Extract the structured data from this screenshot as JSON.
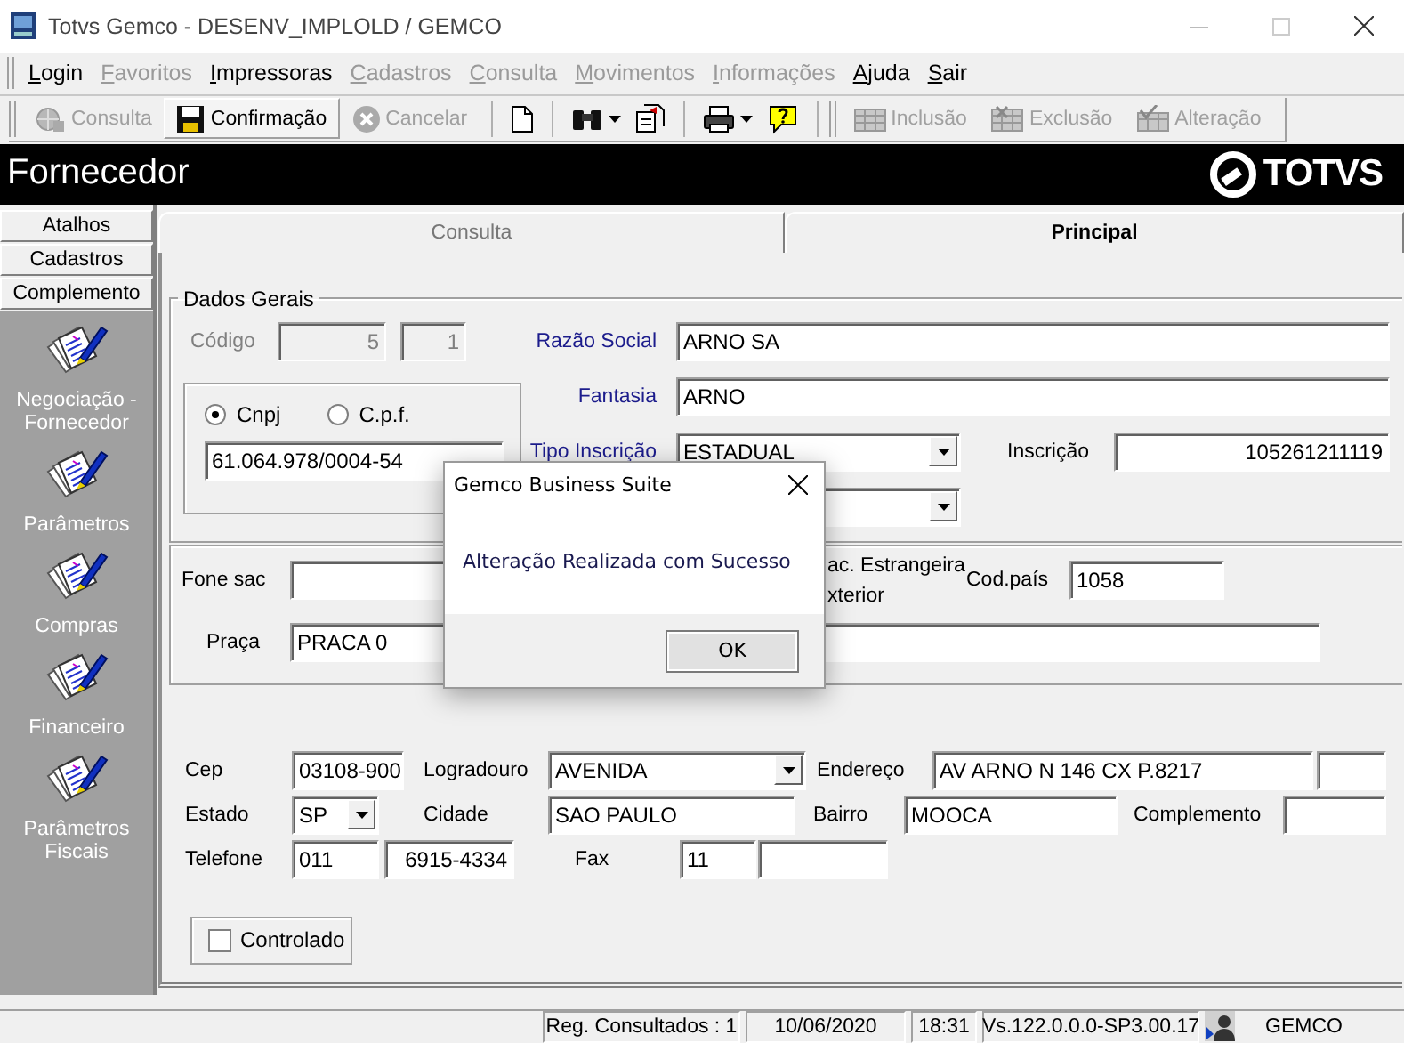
{
  "window": {
    "title": "Totvs Gemco - DESENV_IMPLOLD / GEMCO"
  },
  "menu": [
    {
      "label": "Login",
      "disabled": false
    },
    {
      "label": "Favoritos",
      "disabled": true
    },
    {
      "label": "Impressoras",
      "disabled": false
    },
    {
      "label": "Cadastros",
      "disabled": true
    },
    {
      "label": "Consulta",
      "disabled": true
    },
    {
      "label": "Movimentos",
      "disabled": true
    },
    {
      "label": "Informações",
      "disabled": true
    },
    {
      "label": "Ajuda",
      "disabled": false
    },
    {
      "label": "Sair",
      "disabled": false
    }
  ],
  "toolbar": {
    "left_buttons": [
      {
        "label": "Consulta",
        "disabled": true
      },
      {
        "label": "Confirmação",
        "disabled": false
      },
      {
        "label": "Cancelar",
        "disabled": true
      }
    ],
    "right_buttons": [
      {
        "label": "Inclusão",
        "disabled": true
      },
      {
        "label": "Exclusão",
        "disabled": true
      },
      {
        "label": "Alteração",
        "disabled": true
      }
    ]
  },
  "header": {
    "title": "Fornecedor",
    "logo": "TOTVS"
  },
  "sidebar": {
    "sections": [
      {
        "label": "Atalhos"
      },
      {
        "label": "Cadastros"
      },
      {
        "label": "Complemento"
      }
    ],
    "items": [
      {
        "label": "Negociação - Fornecedor"
      },
      {
        "label": "Parâmetros"
      },
      {
        "label": "Compras"
      },
      {
        "label": "Financeiro"
      },
      {
        "label": "Parâmetros Fiscais"
      }
    ]
  },
  "tabs": [
    {
      "label": "Consulta",
      "selected": false
    },
    {
      "label": "Principal",
      "selected": true
    }
  ],
  "form": {
    "dados_gerais": {
      "legend": "Dados Gerais",
      "codigo": {
        "label": "Código",
        "values": [
          "5",
          "1"
        ],
        "disabled": true
      },
      "document_type": {
        "options": [
          {
            "label": "Cnpj",
            "selected": true
          },
          {
            "label": "C.p.f.",
            "selected": false
          }
        ],
        "value": "61.064.978/0004-54"
      },
      "razao_social": {
        "label": "Razão Social",
        "value": "ARNO SA",
        "required": true
      },
      "fantasia": {
        "label": "Fantasia",
        "value": "ARNO",
        "required": true
      },
      "tipo_inscricao": {
        "label": "Tipo Inscrição",
        "value": "ESTADUAL",
        "required": true
      },
      "inscricao": {
        "label": "Inscrição",
        "value": "105261211119",
        "required": false
      }
    },
    "contato": {
      "fone_sac": {
        "label": "Fone sac"
      },
      "origin_options": [
        "ac. Estrangeira",
        "xterior"
      ],
      "cod_pais": {
        "label": "Cod.país",
        "value": "1058"
      },
      "praca": {
        "label": "Praça",
        "value": "PRACA 0"
      }
    },
    "endereco": {
      "cep": {
        "label": "Cep",
        "value": "03108-900"
      },
      "logradouro": {
        "label": "Logradouro",
        "value": "AVENIDA"
      },
      "endereco": {
        "label": "Endereço",
        "value": "AV ARNO N 146 CX P.8217"
      },
      "estado": {
        "label": "Estado",
        "value": "SP"
      },
      "cidade": {
        "label": "Cidade",
        "value": "SAO PAULO"
      },
      "bairro": {
        "label": "Bairro",
        "value": "MOOCA"
      },
      "complemento": {
        "label": "Complemento"
      },
      "telefone": {
        "label": "Telefone",
        "ddd": "011",
        "number": "6915-4334"
      },
      "fax": {
        "label": "Fax",
        "ddd": "11"
      }
    },
    "controlado": {
      "label": "Controlado",
      "checked": false
    }
  },
  "dialog": {
    "title": "Gemco Business Suite",
    "message": "Alteração Realizada com Sucesso",
    "button": "OK"
  },
  "status_bar": {
    "records": "Reg. Consultados : 1",
    "date": "10/06/2020",
    "time": "18:31",
    "version": "Vs.122.0.0.0-SP3.00.17",
    "user": "GEMCO"
  }
}
